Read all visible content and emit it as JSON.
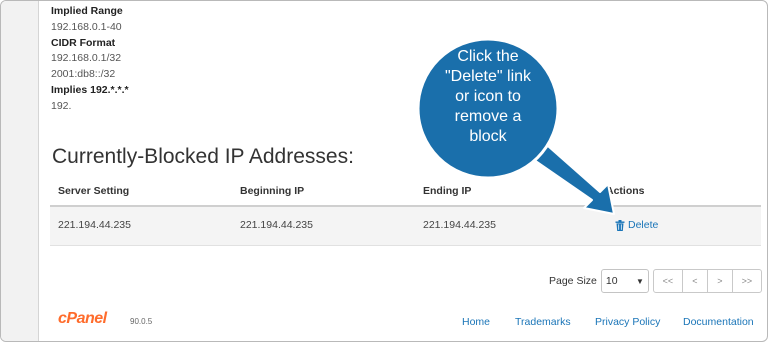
{
  "examples": [
    {
      "label": "Implied Range",
      "values": [
        "192.168.0.1-40"
      ]
    },
    {
      "label": "CIDR Format",
      "values": [
        "192.168.0.1/32",
        "2001:db8::/32"
      ]
    },
    {
      "label": "Implies 192.*.*.*",
      "values": [
        "192."
      ]
    }
  ],
  "section_title": "Currently-Blocked IP Addresses:",
  "table": {
    "headers": [
      "Server Setting",
      "Beginning IP",
      "Ending IP",
      "Actions"
    ],
    "rows": [
      {
        "server_setting": "221.194.44.235",
        "beginning_ip": "221.194.44.235",
        "ending_ip": "221.194.44.235",
        "action": "Delete"
      }
    ]
  },
  "pager": {
    "label": "Page Size",
    "page_size": "10",
    "buttons": [
      "<<",
      "<",
      ">",
      ">>"
    ]
  },
  "footer": {
    "logo": "cPanel",
    "version": "90.0.5",
    "links": [
      "Home",
      "Trademarks",
      "Privacy Policy",
      "Documentation"
    ]
  },
  "callout": {
    "lines": [
      "Click the",
      "\"Delete\" link",
      "or icon to",
      "remove a",
      "block"
    ]
  },
  "colors": {
    "callout_fill": "#1a6fab",
    "link": "#1a75b8",
    "brand": "#ff6c2c"
  }
}
